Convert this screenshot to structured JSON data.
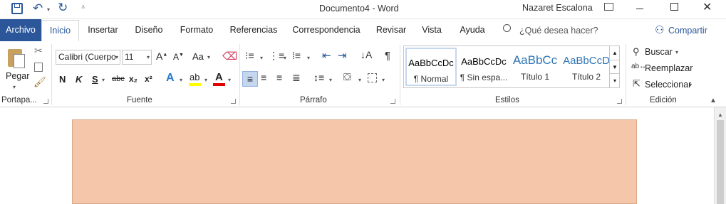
{
  "window": {
    "title": "Documento4 - Word",
    "user": "Nazaret Escalona"
  },
  "tabs": [
    "Archivo",
    "Inicio",
    "Insertar",
    "Diseño",
    "Formato",
    "Referencias",
    "Correspondencia",
    "Revisar",
    "Vista",
    "Ayuda"
  ],
  "search": {
    "placeholder": "¿Qué desea hacer?"
  },
  "share": "Compartir",
  "clipboard": {
    "paste": "Pegar",
    "group": "Portapa..."
  },
  "font": {
    "name": "Calibri (Cuerpo",
    "size": "11",
    "group": "Fuente",
    "bold": "N",
    "italic": "K",
    "underline": "S",
    "strike": "abc",
    "sub": "x₂",
    "sup": "x²",
    "case": "Aa"
  },
  "paragraph": {
    "group": "Párrafo"
  },
  "styles": {
    "group": "Estilos",
    "items": [
      {
        "preview": "AaBbCcDc",
        "name": "¶ Normal"
      },
      {
        "preview": "AaBbCcDc",
        "name": "¶ Sin espa..."
      },
      {
        "preview": "AaBbCc",
        "name": "Título 1"
      },
      {
        "preview": "AaBbCcD",
        "name": "Título 2"
      }
    ]
  },
  "editing": {
    "group": "Edición",
    "find": "Buscar",
    "replace": "Reemplazar",
    "select": "Seleccionar"
  },
  "colors": {
    "file_tab": "#2b579a",
    "page": "#f5c6a9",
    "highlight": "#ffff00",
    "font_color": "#e00000"
  }
}
